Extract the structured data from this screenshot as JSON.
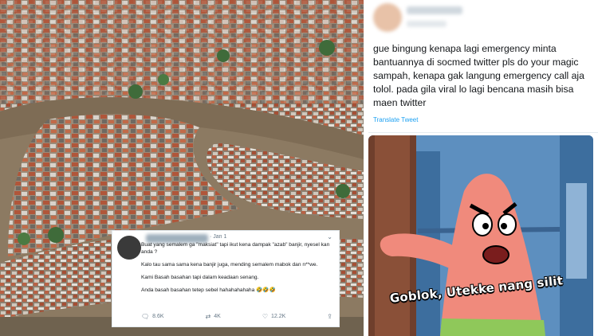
{
  "embedded_tweet": {
    "time": "· Jan 1",
    "menu_icon": "chevron-down-icon",
    "lines": [
      "Buat yang semalem ga \"maksiat\" tapi ikut kena dampak \"azab\" banjir, nyesel kan anda ?",
      "Kalo tau sama sama kena banjir juga, mending semalem mabok dan n**we.",
      "Kami Basah basahan tapi dalam keadaan senang.",
      "Anda basah basahan tetep sebel hahahahahaha 🤣🤣🤣"
    ],
    "actions": {
      "reply_count": "8.6K",
      "retweet_count": "4K",
      "like_count": "12.2K"
    }
  },
  "main_tweet": {
    "text": "gue bingung kenapa lagi emergency minta bantuannya di socmed twitter pls do your magic sampah, kenapa gak langung emergency call aja tolol. pada gila viral lo lagi bencana masih bisa maen twitter",
    "translate_label": "Translate Tweet"
  },
  "meme": {
    "caption": "Goblok, Utekke nang silit"
  },
  "colors": {
    "link": "#1da1f2",
    "text": "#14171a",
    "muted": "#657786"
  }
}
